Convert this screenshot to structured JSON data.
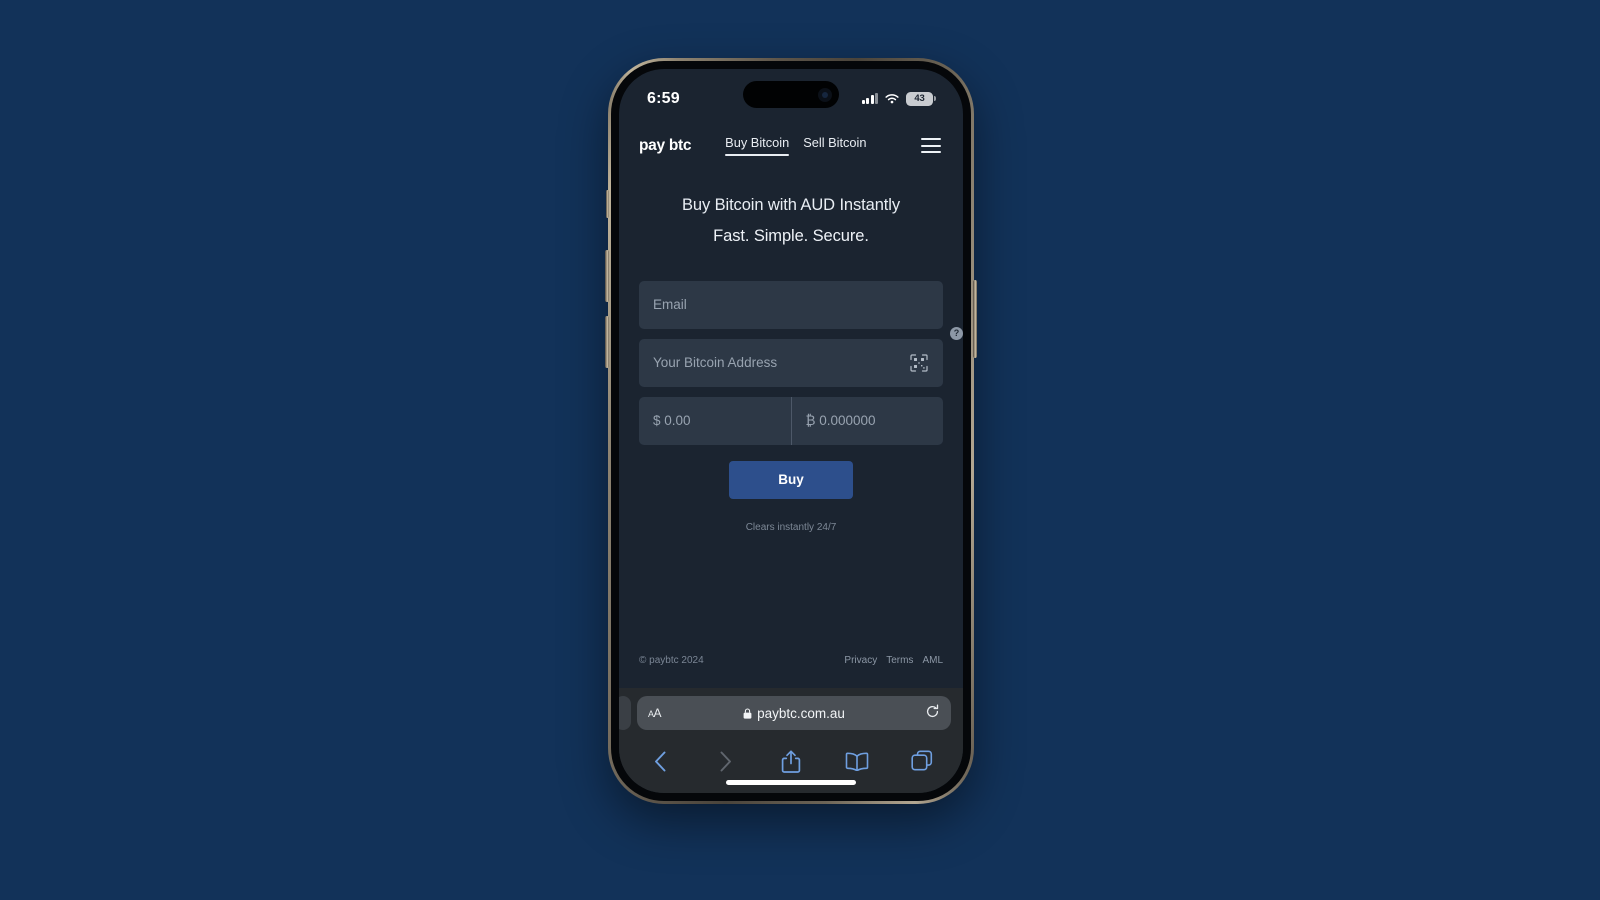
{
  "background_color": "#123259",
  "device": {
    "frame": "iphone-titanium",
    "status_bar": {
      "time": "6:59",
      "cellular_icon": "signal-bars-icon",
      "wifi_icon": "wifi-icon",
      "battery_level": "43"
    },
    "home_indicator": true
  },
  "site": {
    "logo": "pay btc",
    "nav": [
      {
        "label": "Buy Bitcoin",
        "active": true
      },
      {
        "label": "Sell Bitcoin",
        "active": false
      }
    ],
    "menu_icon": "hamburger-menu-icon",
    "hero": {
      "headline": "Buy Bitcoin with AUD Instantly",
      "subheadline": "Fast. Simple. Secure."
    },
    "form": {
      "email_placeholder": "Email",
      "address_placeholder": "Your Bitcoin Address",
      "scan_icon": "qr-code-scan-icon",
      "help_icon": "help-question-icon",
      "help_label": "?",
      "fiat_placeholder": "$ 0.00",
      "btc_placeholder": "₿ 0.000000",
      "submit_label": "Buy",
      "submit_color": "#2d4f8c"
    },
    "tagline": "Clears instantly 24/7",
    "footer": {
      "copyright": "© paybtc 2024",
      "links": [
        "Privacy",
        "Terms",
        "AML"
      ]
    }
  },
  "browser": {
    "text_size_label": "AA",
    "lock_icon": "lock-icon",
    "url": "paybtc.com.au",
    "reload_icon": "reload-icon",
    "toolbar": [
      {
        "name": "back-button",
        "icon": "chevron-left-icon",
        "enabled": true
      },
      {
        "name": "forward-button",
        "icon": "chevron-right-icon",
        "enabled": false
      },
      {
        "name": "share-button",
        "icon": "share-icon",
        "enabled": true
      },
      {
        "name": "bookmarks-button",
        "icon": "book-icon",
        "enabled": true
      },
      {
        "name": "tabs-button",
        "icon": "tabs-icon",
        "enabled": true
      }
    ]
  }
}
